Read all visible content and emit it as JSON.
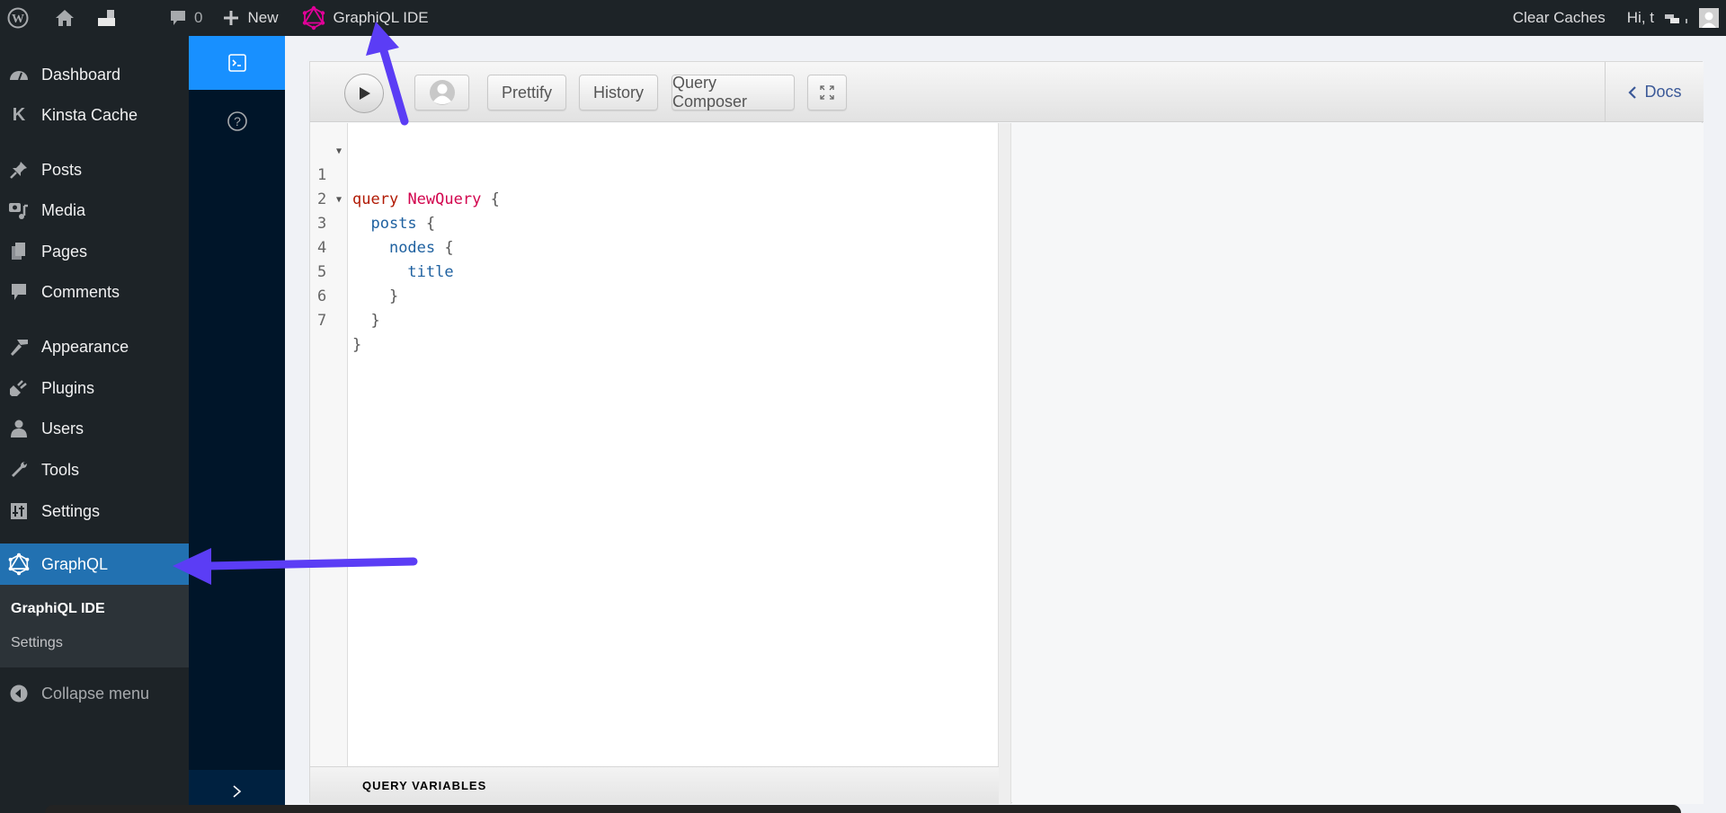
{
  "admin_bar": {
    "comments_count": "0",
    "new_label": "New",
    "graphiql_label": "GraphiQL IDE",
    "clear_caches_label": "Clear Caches",
    "greeting": "Hi, t"
  },
  "sidebar": {
    "items": [
      {
        "label": "Dashboard",
        "icon": "dashboard-icon"
      },
      {
        "label": "Kinsta Cache",
        "icon": "kinsta-icon"
      },
      {
        "label": "Posts",
        "icon": "pin-icon"
      },
      {
        "label": "Media",
        "icon": "media-icon"
      },
      {
        "label": "Pages",
        "icon": "pages-icon"
      },
      {
        "label": "Comments",
        "icon": "comment-icon"
      },
      {
        "label": "Appearance",
        "icon": "brush-icon"
      },
      {
        "label": "Plugins",
        "icon": "plugin-icon"
      },
      {
        "label": "Users",
        "icon": "user-icon"
      },
      {
        "label": "Tools",
        "icon": "wrench-icon"
      },
      {
        "label": "Settings",
        "icon": "settings-icon"
      },
      {
        "label": "GraphQL",
        "icon": "graphql-icon",
        "active": true
      }
    ],
    "submenu": [
      "GraphiQL IDE",
      "Settings"
    ],
    "collapse_label": "Collapse menu",
    "active_color": "#2271b1"
  },
  "toolbar": {
    "prettify_label": "Prettify",
    "history_label": "History",
    "query_composer_label": "Query Composer",
    "docs_label": "Docs"
  },
  "editor": {
    "lines": [
      {
        "n": "1",
        "fold": true
      },
      {
        "n": "2",
        "fold": true
      },
      {
        "n": "3"
      },
      {
        "n": "4"
      },
      {
        "n": "5"
      },
      {
        "n": "6"
      },
      {
        "n": "7"
      }
    ],
    "code": {
      "l1_kw": "query",
      "l1_name": "NewQuery",
      "l1_brace": "{",
      "l2_field": "posts",
      "l2_brace": "{",
      "l3_field": "nodes",
      "l3_brace": "{",
      "l4_field": "title",
      "l5_brace": "}",
      "l6_brace": "}",
      "l7_brace": "}"
    }
  },
  "query_variables_label": "QUERY VARIABLES",
  "annotation_color": "#5b3df5"
}
